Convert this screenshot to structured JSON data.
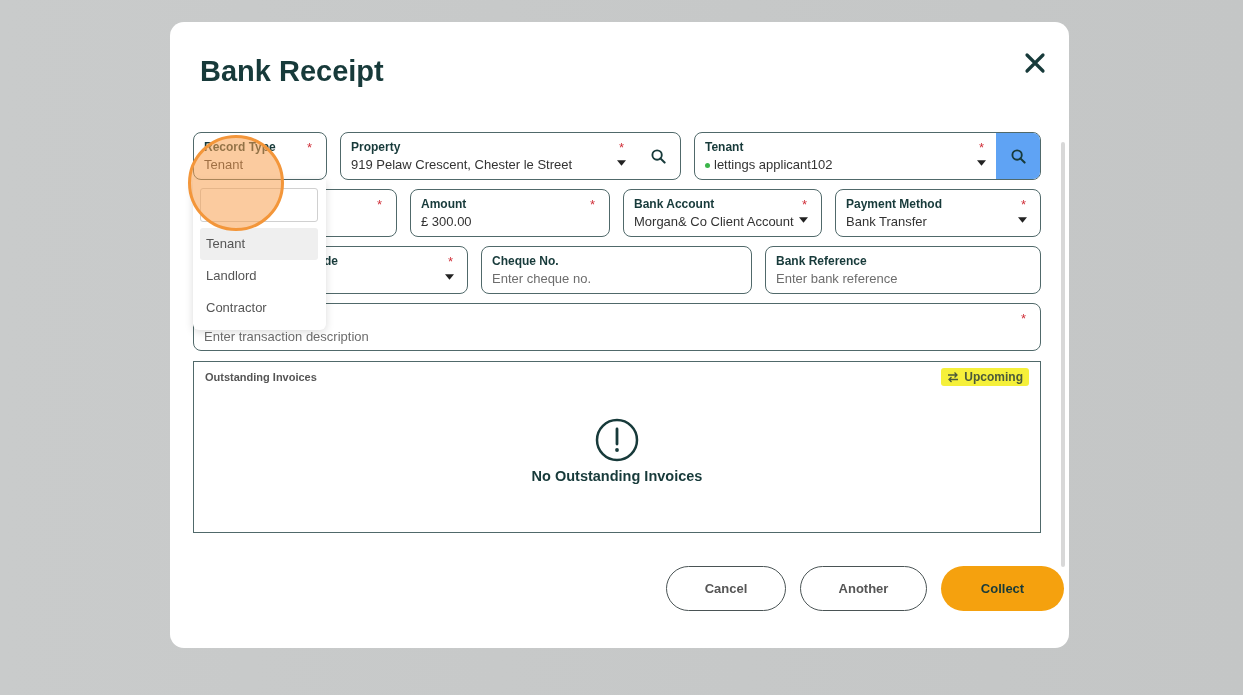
{
  "dialog": {
    "title": "Bank Receipt",
    "rows": [
      [
        {
          "kind": "plain",
          "label": "Record Type",
          "value": "Tenant",
          "required_mark": "*"
        },
        {
          "kind": "search-select",
          "label": "Property",
          "value": "919 Pelaw Crescent, Chester le Street",
          "required_mark": "*"
        },
        {
          "kind": "search-select-button",
          "label": "Tenant",
          "value": "lettings applicant102",
          "required_mark": "*"
        }
      ],
      [
        {
          "kind": "covered",
          "required_mark": "*"
        },
        {
          "kind": "input",
          "label": "Amount",
          "value": "£ 300.00",
          "required_mark": "*"
        },
        {
          "kind": "select",
          "label": "Bank Account",
          "value": "Morgan& Co Client Account",
          "required_mark": "*"
        },
        {
          "kind": "select",
          "label": "Payment Method",
          "value": "Bank Transfer",
          "required_mark": "*"
        }
      ],
      [
        {
          "kind": "covered-select",
          "label": "de",
          "required_mark": "*"
        },
        {
          "kind": "input",
          "label": "Cheque No.",
          "placeholder": "Enter cheque no."
        },
        {
          "kind": "input",
          "label": "Bank Reference",
          "placeholder": "Enter bank reference"
        }
      ],
      [
        {
          "kind": "covered",
          "placeholder": "Enter transaction description",
          "required_mark": "*"
        }
      ]
    ],
    "dropdown": {
      "options": [
        {
          "label": "Tenant",
          "selected": true
        },
        {
          "label": "Landlord",
          "selected": false
        },
        {
          "label": "Contractor",
          "selected": false
        }
      ]
    },
    "invoices": {
      "title": "Outstanding Invoices",
      "badge": "Upcoming",
      "empty_text": "No Outstanding Invoices"
    },
    "buttons": [
      {
        "label": "Cancel",
        "kind": "outline"
      },
      {
        "label": "Another",
        "kind": "outline"
      },
      {
        "label": "Collect",
        "kind": "primary"
      }
    ]
  }
}
